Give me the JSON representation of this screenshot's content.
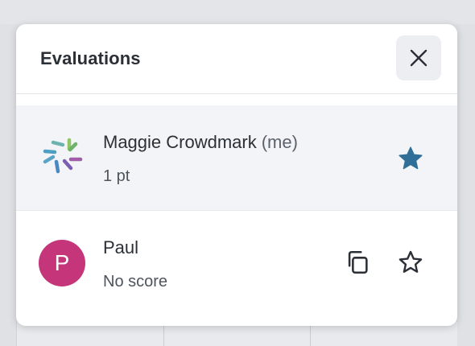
{
  "panel": {
    "title": "Evaluations",
    "close_icon": "close-icon"
  },
  "evaluations": [
    {
      "name": "Maggie Crowdmark",
      "me_tag": "(me)",
      "score": "1 pt",
      "avatar_icon": "crowdmark-logo",
      "starred": true,
      "star_icon": "star-filled-icon",
      "selected": true
    },
    {
      "name": "Paul",
      "score": "No score",
      "avatar_letter": "P",
      "avatar_color": "#c4357a",
      "starred": false,
      "copy_icon": "copy-icon",
      "star_icon": "star-outline-icon"
    }
  ],
  "colors": {
    "star_active": "#2f6f97",
    "selected_row_bg": "#f2f4f8"
  }
}
